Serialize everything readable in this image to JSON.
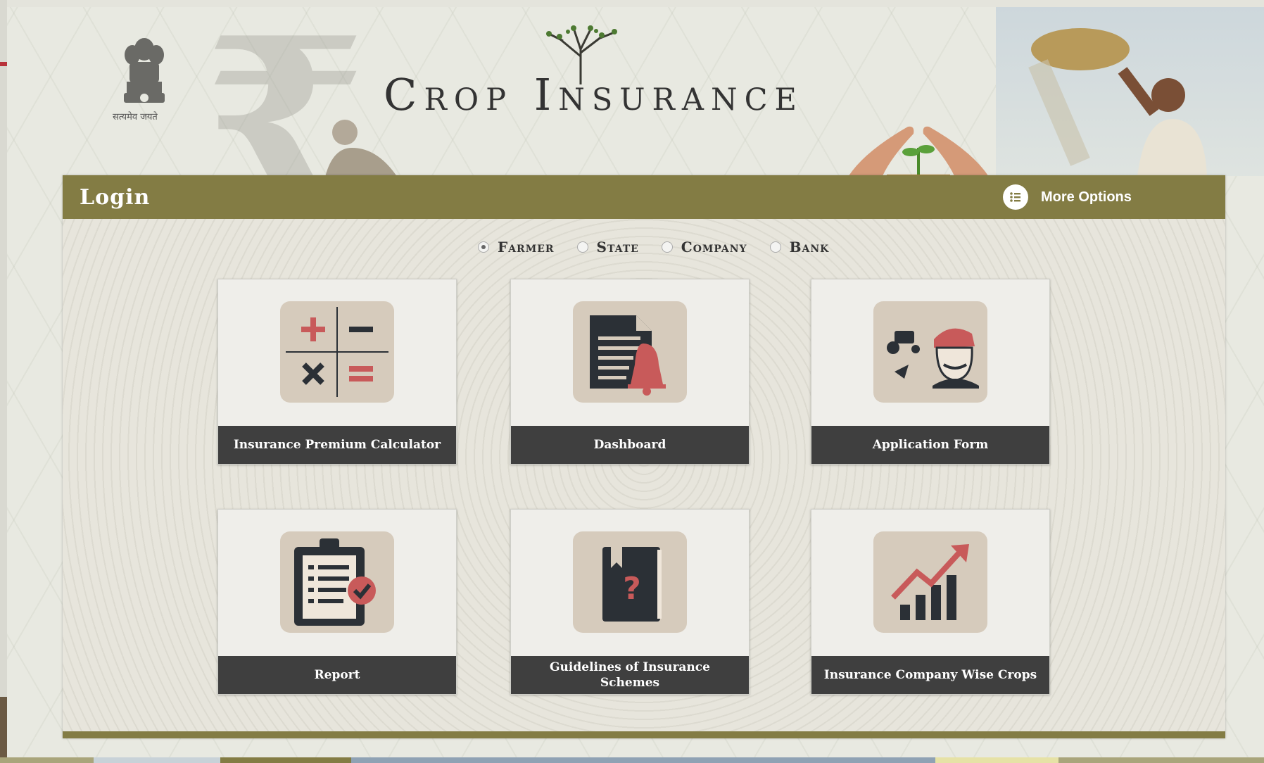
{
  "banner": {
    "title": "Crop Insurance",
    "emblem_motto": "सत्यमेव जयते"
  },
  "panel": {
    "title": "Login",
    "more_options": "More Options"
  },
  "roles": [
    {
      "label": "Farmer",
      "selected": true
    },
    {
      "label": "State",
      "selected": false
    },
    {
      "label": "Company",
      "selected": false
    },
    {
      "label": "Bank",
      "selected": false
    }
  ],
  "tiles": [
    {
      "label": "Insurance Premium Calculator",
      "icon": "calculator-icon"
    },
    {
      "label": "Dashboard",
      "icon": "document-bell-icon"
    },
    {
      "label": "Application Form",
      "icon": "farmer-tractor-icon"
    },
    {
      "label": "Report",
      "icon": "clipboard-check-icon"
    },
    {
      "label": "Guidelines of Insurance Schemes",
      "icon": "help-book-icon"
    },
    {
      "label": "Insurance Company Wise Crops",
      "icon": "growth-chart-icon"
    }
  ],
  "colors": {
    "header_bar": "#837c44",
    "tile_caption": "#3f3f3f",
    "icon_bg": "#d6cbbc",
    "accent_red": "#c85a5a",
    "icon_dark": "#2b3036"
  }
}
